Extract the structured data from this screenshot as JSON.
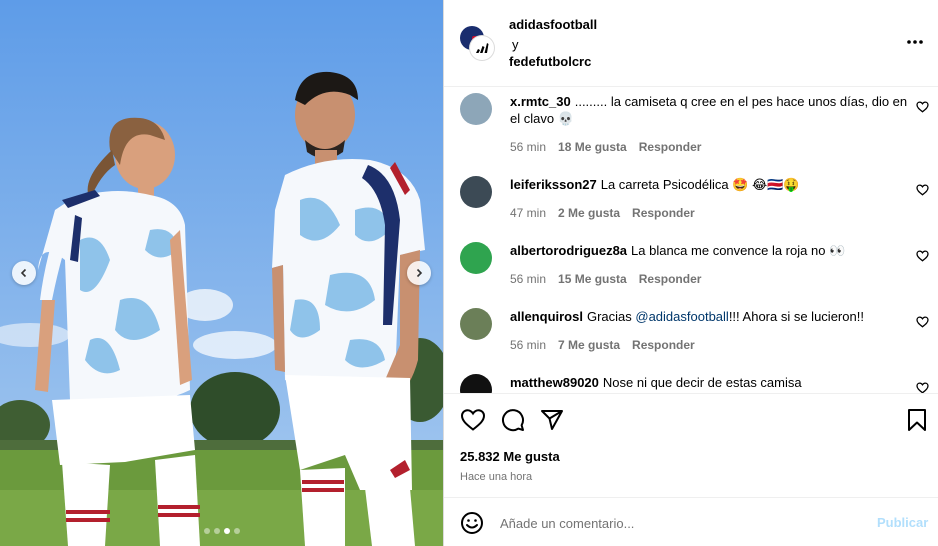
{
  "post": {
    "authors": [
      "adidasfootball",
      "fedefutbolcrc"
    ],
    "author_separator": "y",
    "likes": "25.832 Me gusta",
    "time_ago": "Hace una hora"
  },
  "carousel": {
    "slides": 4,
    "active_index": 2
  },
  "icons": {
    "more": "more-horizontal-icon",
    "like": "heart-icon",
    "comment": "comment-bubble-icon",
    "share": "paper-plane-icon",
    "save": "bookmark-icon",
    "emoji": "smiley-icon"
  },
  "comments": [
    {
      "username": "x.rmtc_30",
      "text": "......... la camiseta q cree en el pes hace unos días, dio en el clavo 💀",
      "time": "56 min",
      "likes": "18 Me gusta",
      "reply": "Responder",
      "avatar_color": "#8da6b8"
    },
    {
      "username": "leiferiksson27",
      "text": "La carreta Psicodélica 🤩 😂🇨🇷🤑",
      "time": "47 min",
      "likes": "2 Me gusta",
      "reply": "Responder",
      "avatar_color": "#3c4a55"
    },
    {
      "username": "albertorodriguez8a",
      "text": "La blanca me convence la roja no 👀",
      "time": "56 min",
      "likes": "15 Me gusta",
      "reply": "Responder",
      "avatar_color": "#2fa44f"
    },
    {
      "username": "allenquirosl",
      "text_before": "Gracias ",
      "mention": "@adidasfootball",
      "text_after": "!!! Ahora si se lucieron!!",
      "time": "56 min",
      "likes": "7 Me gusta",
      "reply": "Responder",
      "avatar_color": "#6b7f58"
    },
    {
      "username": "matthew89020",
      "text": "Nose ni que decir de estas camisa",
      "avatar_color": "#111111"
    }
  ],
  "composer": {
    "placeholder": "Añade un comentario...",
    "post_label": "Publicar"
  },
  "colors": {
    "mention": "#00376b",
    "muted": "#737373",
    "post_disabled": "#b2dffc"
  }
}
